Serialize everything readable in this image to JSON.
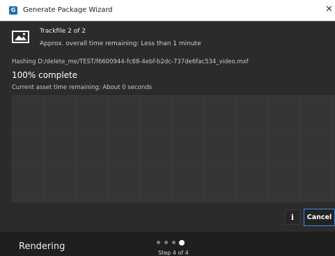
{
  "window": {
    "title": "Generate Package Wizard",
    "close_glyph": "✕",
    "app_icon_glyph": "G"
  },
  "progress": {
    "trackfile": "Trackfile 2 of 2",
    "approx_time": "Approx. overall time remaining: Less than 1 minute",
    "hashing": "Hashing D:/delete_me/TEST/f6600944-fc88-4ebf-b2dc-737de6fac534_video.mxf",
    "percent": "100% complete",
    "percent_value": 100,
    "asset_time": "Current asset time remaining: About 0 seconds"
  },
  "actions": {
    "info_label": "i",
    "cancel_label": "Cancel"
  },
  "footer": {
    "stage": "Rendering",
    "step_label": "Step 4 of 4",
    "current_step": 4,
    "total_steps": 4
  },
  "colors": {
    "background": "#2b2b2b",
    "accent": "#3b8ee6",
    "titlebar": "#ffffff"
  },
  "icons": {
    "app": "app-logo-icon",
    "image": "image-icon",
    "close": "close-icon",
    "info": "info-icon"
  }
}
